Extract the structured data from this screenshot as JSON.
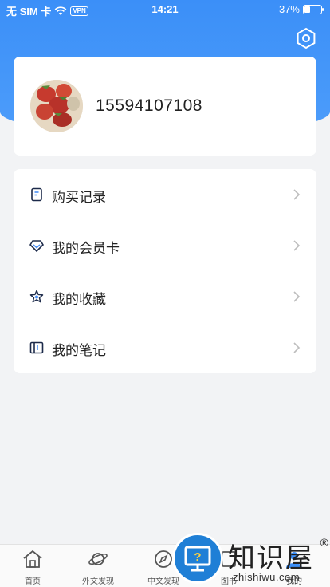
{
  "status_bar": {
    "carrier": "无 SIM 卡",
    "vpn": "VPN",
    "time": "14:21",
    "battery_text": "37%",
    "battery_level": 0.37
  },
  "profile": {
    "phone": "15594107108"
  },
  "menu": {
    "items": [
      {
        "label": "购买记录",
        "icon": "receipt-icon"
      },
      {
        "label": "我的会员卡",
        "icon": "diamond-icon"
      },
      {
        "label": "我的收藏",
        "icon": "star-icon"
      },
      {
        "label": "我的笔记",
        "icon": "notebook-icon"
      }
    ]
  },
  "tab_bar": {
    "tabs": [
      {
        "label": "首页",
        "icon": "home-icon"
      },
      {
        "label": "外文发现",
        "icon": "planet-icon"
      },
      {
        "label": "中文发现",
        "icon": "compass-icon"
      },
      {
        "label": "图书",
        "icon": "book-icon"
      },
      {
        "label": "我的",
        "icon": "user-icon",
        "active": true
      }
    ]
  },
  "watermark": {
    "brand": "知识屋",
    "reg": "®",
    "domain": "zhishiwu.com"
  },
  "colors": {
    "accent": "#3b8ff8",
    "background": "#f2f3f5",
    "watermark_blue": "#1f7fd6"
  }
}
